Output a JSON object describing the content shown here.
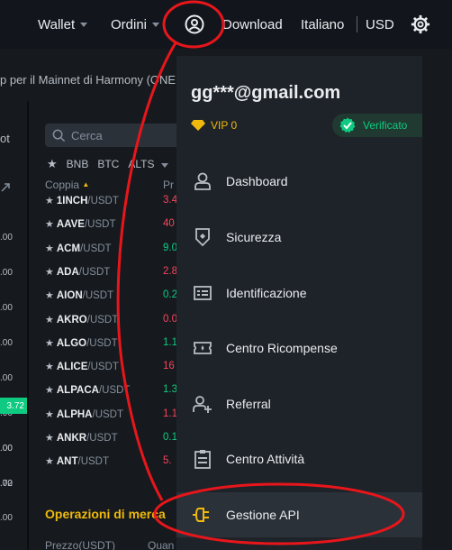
{
  "topbar": {
    "wallet": "Wallet",
    "orders": "Ordini",
    "download": "Download",
    "language": "Italiano",
    "currency": "USD"
  },
  "banner": {
    "text": "p per il Mainnet di Harmony (ONE"
  },
  "left_column": {
    "header": "ot",
    "values": [
      ".00",
      ".00",
      ".00",
      ".00",
      ".00",
      ".00",
      ".00"
    ],
    "badge": "3.72",
    "values_bottom": [
      ".00",
      ".72",
      ".00"
    ]
  },
  "market": {
    "search_placeholder": "Cerca",
    "filters": [
      "BNB",
      "BTC",
      "ALTS"
    ],
    "col_pair": "Coppia",
    "col_price": "Pr",
    "rows": [
      {
        "base": "1INCH",
        "quote": "/USDT",
        "price": "3.4"
      },
      {
        "base": "AAVE",
        "quote": "/USDT",
        "price": "40"
      },
      {
        "base": "ACM",
        "quote": "/USDT",
        "price": "9.0"
      },
      {
        "base": "ADA",
        "quote": "/USDT",
        "price": "2.8"
      },
      {
        "base": "AION",
        "quote": "/USDT",
        "price": "0.2"
      },
      {
        "base": "AKRO",
        "quote": "/USDT",
        "price": "0.0"
      },
      {
        "base": "ALGO",
        "quote": "/USDT",
        "price": "1.1"
      },
      {
        "base": "ALICE",
        "quote": "/USDT",
        "price": "16"
      },
      {
        "base": "ALPACA",
        "quote": "/USDT",
        "price": "1.3"
      },
      {
        "base": "ALPHA",
        "quote": "/USDT",
        "price": "1.1"
      },
      {
        "base": "ANKR",
        "quote": "/USDT",
        "price": "0.1"
      },
      {
        "base": "ANT",
        "quote": "/USDT",
        "price": "5."
      }
    ],
    "price_colors": [
      "#f6465d",
      "#f6465d",
      "#0ecb81",
      "#f6465d",
      "#0ecb81",
      "#f6465d",
      "#0ecb81",
      "#f6465d",
      "#0ecb81",
      "#f6465d",
      "#0ecb81",
      "#f6465d"
    ],
    "trades_title": "Operazioni di merca",
    "trades_col_price": "Prezzo(USDT)",
    "trades_col_qty": "Quan"
  },
  "dropdown": {
    "email": "gg***@gmail.com",
    "vip": "VIP 0",
    "verified": "Verificato",
    "items": [
      {
        "label": "Dashboard",
        "icon": "user-icon"
      },
      {
        "label": "Sicurezza",
        "icon": "shield-icon"
      },
      {
        "label": "Identificazione",
        "icon": "id-card-icon"
      },
      {
        "label": "Centro Ricompense",
        "icon": "ticket-icon"
      },
      {
        "label": "Referral",
        "icon": "add-user-icon"
      },
      {
        "label": "Centro Attività",
        "icon": "clipboard-icon"
      },
      {
        "label": "Gestione API",
        "icon": "api-plug-icon"
      }
    ]
  },
  "colors": {
    "brand_yellow": "#f0b90b",
    "up_green": "#0ecb81",
    "down_red": "#f6465d",
    "annotation_red": "#e8161b"
  }
}
